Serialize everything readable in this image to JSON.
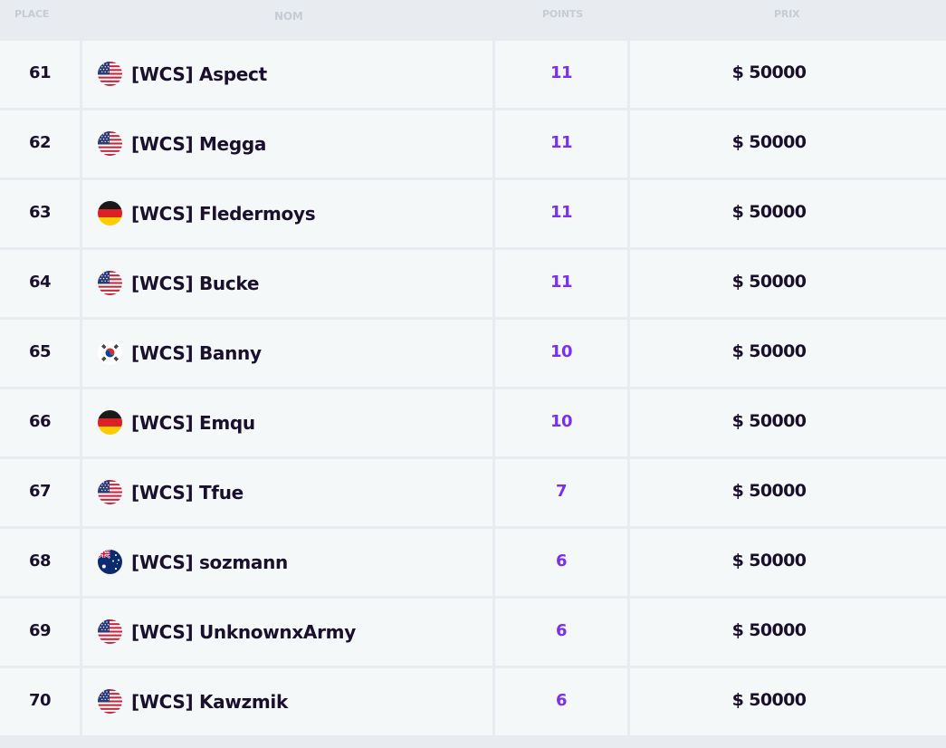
{
  "header": {
    "place": "PLACE",
    "name": "NOM",
    "points": "POINTS",
    "prize": "PRIX"
  },
  "colors": {
    "text_dark": "#1b0f2e",
    "points_purple": "#7b2ff2",
    "row_bg": "#f4f8f8",
    "header_text": "#c6ccd3",
    "background": "#e8ecf0"
  },
  "rows": [
    {
      "place": "61",
      "flag": "us-flag-icon",
      "name": "[WCS] Aspect",
      "points": "11",
      "prize": "$ 50000"
    },
    {
      "place": "62",
      "flag": "us-flag-icon",
      "name": "[WCS] Megga",
      "points": "11",
      "prize": "$ 50000"
    },
    {
      "place": "63",
      "flag": "de-flag-icon",
      "name": "[WCS] Fledermoys",
      "points": "11",
      "prize": "$ 50000"
    },
    {
      "place": "64",
      "flag": "us-flag-icon",
      "name": "[WCS] Bucke",
      "points": "11",
      "prize": "$ 50000"
    },
    {
      "place": "65",
      "flag": "kr-flag-icon",
      "name": "[WCS] Banny",
      "points": "10",
      "prize": "$ 50000"
    },
    {
      "place": "66",
      "flag": "de-flag-icon",
      "name": "[WCS] Emqu",
      "points": "10",
      "prize": "$ 50000"
    },
    {
      "place": "67",
      "flag": "us-flag-icon",
      "name": "[WCS] Tfue",
      "points": "7",
      "prize": "$ 50000"
    },
    {
      "place": "68",
      "flag": "au-flag-icon",
      "name": "[WCS] sozmann",
      "points": "6",
      "prize": "$ 50000"
    },
    {
      "place": "69",
      "flag": "us-flag-icon",
      "name": "[WCS] UnknownxArmy",
      "points": "6",
      "prize": "$ 50000"
    },
    {
      "place": "70",
      "flag": "us-flag-icon",
      "name": "[WCS] Kawzmik",
      "points": "6",
      "prize": "$ 50000"
    }
  ]
}
